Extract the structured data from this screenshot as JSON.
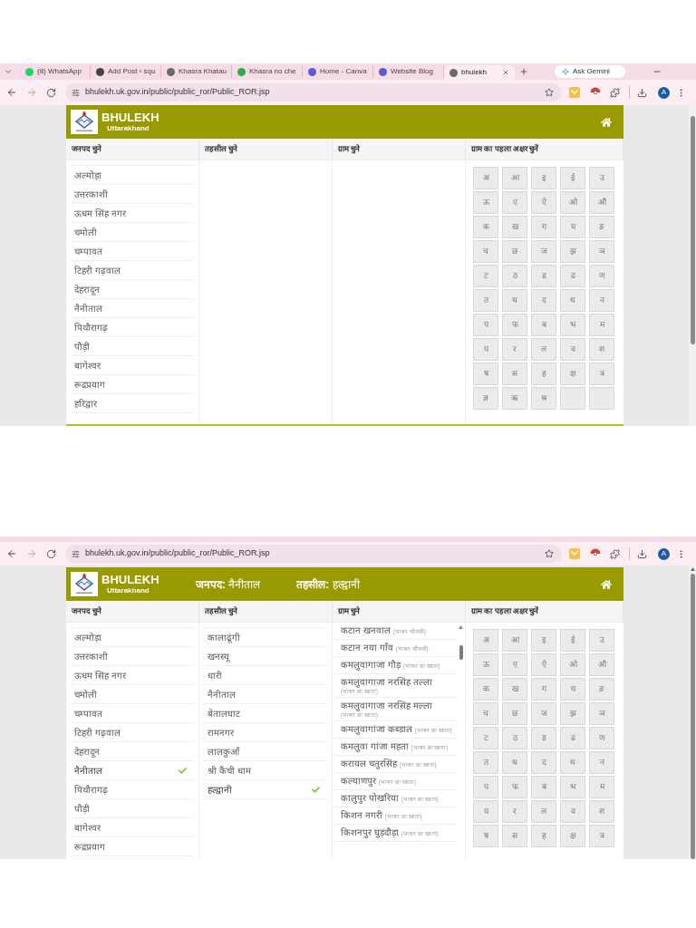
{
  "screens": [
    {
      "browser": {
        "tabs": [
          {
            "title": "(8) WhatsApp",
            "selected": false,
            "color": "#25d366"
          },
          {
            "title": "Add Post ‹ squ",
            "selected": false,
            "color": "#464646"
          },
          {
            "title": "Khasra Khatau",
            "selected": false,
            "color": "#6b6b6b"
          },
          {
            "title": "Khasra no che",
            "selected": false,
            "color": "#34a853"
          },
          {
            "title": "Home - Canva",
            "selected": false,
            "color": "#5b5bd6"
          },
          {
            "title": "Website Blog",
            "selected": false,
            "color": "#5b5bd6"
          },
          {
            "title": "bhulekh",
            "selected": true,
            "color": "#6b6b6b"
          }
        ],
        "gemini_button": "Ask Gemini",
        "url": "bhulekh.uk.gov.in/public/public_ror/Public_ROR.jsp",
        "avatar": "A"
      },
      "header": {
        "brand": "BHULEKH",
        "region": "Uttarakhand"
      },
      "districts": {
        "heading": "जनपद चुने",
        "items": [
          {
            "name": "अल्मोड़ा",
            "selected": false
          },
          {
            "name": "उत्तरकाशी",
            "selected": false
          },
          {
            "name": "ऊधम सिंह नगर",
            "selected": false
          },
          {
            "name": "चमोली",
            "selected": false
          },
          {
            "name": "चम्पावत",
            "selected": false
          },
          {
            "name": "टिहरी गढ़वाल",
            "selected": false
          },
          {
            "name": "देहरादून",
            "selected": false
          },
          {
            "name": "नैनीताल",
            "selected": false
          },
          {
            "name": "पिथौरागढ़",
            "selected": false
          },
          {
            "name": "पौड़ी",
            "selected": false
          },
          {
            "name": "बागेश्वर",
            "selected": false
          },
          {
            "name": "रूद्रप्रयाग",
            "selected": false
          },
          {
            "name": "हरिद्वार",
            "selected": false
          }
        ]
      },
      "tehsils": {
        "heading": "तहसील चुने"
      },
      "villages": {
        "heading": "ग्राम चुने"
      },
      "letters": {
        "heading": "ग्राम का पहला अक्षर चुनें",
        "items": [
          "अ",
          "आ",
          "इ",
          "ई",
          "उ",
          "ऊ",
          "ए",
          "ऐ",
          "ओ",
          "औ",
          "क",
          "ख",
          "ग",
          "घ",
          "ङ",
          "च",
          "छ",
          "ज",
          "झ",
          "ञ",
          "ट",
          "ठ",
          "ड",
          "ढ",
          "ण",
          "त",
          "थ",
          "द",
          "ध",
          "न",
          "प",
          "फ",
          "ब",
          "भ",
          "म",
          "य",
          "र",
          "ल",
          "व",
          "श",
          "ष",
          "स",
          "ह",
          "क्ष",
          "त्र",
          "ज्ञ",
          "ऋ",
          "श्र"
        ]
      }
    },
    {
      "browser": {
        "url": "bhulekh.uk.gov.in/public/public_ror/Public_ROR.jsp",
        "avatar": "A"
      },
      "header": {
        "brand": "BHULEKH",
        "region": "Uttarakhand",
        "selection": [
          "**जनपद:** नैनीताल",
          "**तहसील:** हल्द्वानी"
        ]
      },
      "districts": {
        "heading": "जनपद चुने",
        "items": [
          {
            "name": "अल्मोड़ा",
            "selected": false
          },
          {
            "name": "उत्तरकाशी",
            "selected": false
          },
          {
            "name": "ऊधम सिंह नगर",
            "selected": false
          },
          {
            "name": "चमोली",
            "selected": false
          },
          {
            "name": "चम्पावत",
            "selected": false
          },
          {
            "name": "टिहरी गढ़वाल",
            "selected": false
          },
          {
            "name": "देहरादून",
            "selected": false
          },
          {
            "name": "नैनीताल",
            "selected": true
          },
          {
            "name": "पिथौरागढ़",
            "selected": false
          },
          {
            "name": "पौड़ी",
            "selected": false
          },
          {
            "name": "बागेश्वर",
            "selected": false
          },
          {
            "name": "रूद्रप्रयाग",
            "selected": false
          }
        ]
      },
      "tehsils": {
        "heading": "तहसील चुने",
        "items": [
          {
            "name": "कालाढूंगी",
            "selected": false
          },
          {
            "name": "खनस्यू",
            "selected": false
          },
          {
            "name": "धारी",
            "selected": false
          },
          {
            "name": "नैनीताल",
            "selected": false
          },
          {
            "name": "बेतालघाट",
            "selected": false
          },
          {
            "name": "रामनगर",
            "selected": false
          },
          {
            "name": "लालकुआँ",
            "selected": false
          },
          {
            "name": "श्री कैंची धाम",
            "selected": false
          },
          {
            "name": "हल्द्वानी",
            "selected": true
          }
        ]
      },
      "villages": {
        "heading": "ग्राम चुने",
        "items": [
          {
            "name": "कटान खनवाल",
            "area": "(भाबर चौमसी)"
          },
          {
            "name": "कटान नया गाँव",
            "area": "(भाबर चौमसी)"
          },
          {
            "name": "कमलुवागाजा गौड़",
            "area": "(भाबर छः खाता)"
          },
          {
            "name": "कमलुवागाजा नरसिंह तल्ला",
            "area": "(भाबर छः खाता)"
          },
          {
            "name": "कमलुवागाजा नरसिंह मल्ला",
            "area": "(भाबर छः खाता)"
          },
          {
            "name": "कमलुवागांजा कब्डाल",
            "area": "(भाबर छः खाता)"
          },
          {
            "name": "कमलुवा गांजा महता",
            "area": "(भाबर छः खाता)"
          },
          {
            "name": "करायल चतुरसिंह",
            "area": "(भाबर छः खाता)"
          },
          {
            "name": "कल्याणपुर",
            "area": "(भाबर छः खाता)"
          },
          {
            "name": "कालुपुर पोखरिया",
            "area": "(भाबर छः खाता)"
          },
          {
            "name": "किशन नगरी",
            "area": "(भाबर छः खाता)"
          },
          {
            "name": "किशनपुर घुड़दौड़ा",
            "area": "(भाबर छः खाता)"
          }
        ]
      },
      "letters": {
        "heading": "ग्राम का पहला अक्षर चुनें",
        "items": [
          "अ",
          "आ",
          "इ",
          "ई",
          "उ",
          "ऊ",
          "ए",
          "ऐ",
          "ओ",
          "औ",
          "क",
          "ख",
          "ग",
          "घ",
          "ङ",
          "च",
          "छ",
          "ज",
          "झ",
          "ञ",
          "ट",
          "ठ",
          "ड",
          "ढ",
          "ण",
          "त",
          "थ",
          "द",
          "ध",
          "न",
          "प",
          "फ",
          "ब",
          "भ",
          "म",
          "य",
          "र",
          "ल",
          "व",
          "श",
          "ष",
          "स",
          "ह",
          "क्ष",
          "त्र"
        ]
      }
    }
  ]
}
